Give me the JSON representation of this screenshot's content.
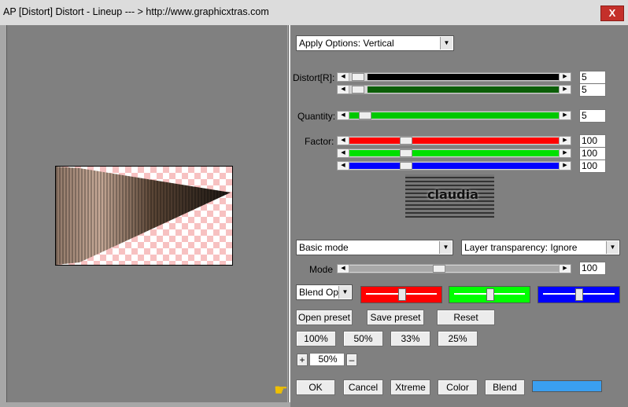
{
  "window": {
    "title": "AP [Distort]  Distort - Lineup    --- > http://www.graphicxtras.com",
    "close_label": "X"
  },
  "apply_options": {
    "value": "Apply Options: Vertical"
  },
  "distort": {
    "label": "Distort[R]:",
    "rows": [
      {
        "value": "5",
        "color": "#000000"
      },
      {
        "value": "5",
        "color": "#0b5e07"
      }
    ]
  },
  "quantity": {
    "label": "Quantity:",
    "value": "5",
    "color": "#00c800"
  },
  "factor": {
    "label": "Factor:",
    "rows": [
      {
        "value": "100",
        "color": "#ff0000"
      },
      {
        "value": "100",
        "color": "#00e000"
      },
      {
        "value": "100",
        "color": "#0000ff"
      }
    ]
  },
  "logo": {
    "text": "claudia"
  },
  "mode_select": {
    "value": "Basic mode"
  },
  "layer_select": {
    "value": "Layer transparency: Ignore"
  },
  "mode": {
    "label": "Mode",
    "value": "100"
  },
  "blend_select": {
    "value": "Blend Optic"
  },
  "blend_swatches": [
    {
      "color": "#ff0000"
    },
    {
      "color": "#00ff00"
    },
    {
      "color": "#0000ff"
    }
  ],
  "presets": {
    "open": "Open preset",
    "save": "Save preset",
    "reset": "Reset"
  },
  "zoom_buttons": [
    "100%",
    "50%",
    "33%",
    "25%"
  ],
  "zoom": {
    "plus": "+",
    "value": "50%",
    "minus": "–"
  },
  "actions": {
    "ok": "OK",
    "cancel": "Cancel",
    "xtreme": "Xtreme",
    "color": "Color",
    "blend": "Blend"
  },
  "color_bar": {
    "color": "#3a9ff0"
  }
}
